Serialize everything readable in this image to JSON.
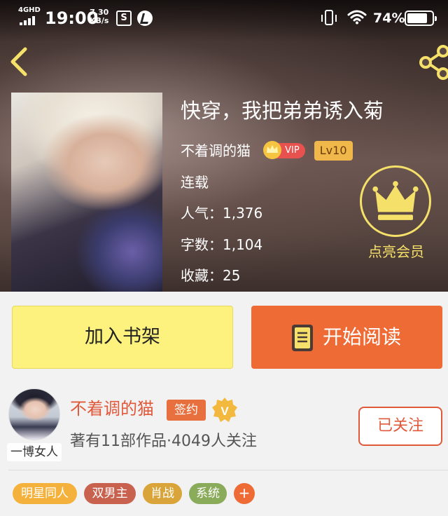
{
  "status_bar": {
    "network": "4GHD",
    "time": "19:00",
    "speed_value": "7.30",
    "speed_unit": "KB/s",
    "battery": "74%",
    "battery_level": 0.74
  },
  "book": {
    "title": "快穿，我把弟弟诱入菊",
    "author": "不着调的猫",
    "vip_label": "VIP",
    "level": "Lv10",
    "status": "连载",
    "popularity": "人气：1,376",
    "word_count": "字数：1,104",
    "favorites": "收藏：25"
  },
  "member": {
    "label": "点亮会员"
  },
  "actions": {
    "add_shelf": "加入书架",
    "start_reading": "开始阅读"
  },
  "author_card": {
    "name": "不着调的猫",
    "sign_badge": "签约",
    "v_badge": "V",
    "summary": "著有11部作品·4049人关注",
    "follow": "已关注",
    "avatar_tag": "一博女人"
  },
  "tags": [
    {
      "label": "明星同人",
      "color": "#f4b23c"
    },
    {
      "label": "双男主",
      "color": "#c8614e"
    },
    {
      "label": "肖战",
      "color": "#d9a53a"
    },
    {
      "label": "系统",
      "color": "#8aab5a"
    },
    {
      "label": "+",
      "color": "#ee6b36"
    }
  ],
  "colors": {
    "accent_orange": "#ee6b36",
    "shelf_yellow": "#fdf27e",
    "author_red": "#e0593b",
    "member_gold": "#f5e06a"
  },
  "icons": {
    "back": "chevron-left-icon",
    "share": "share-icon",
    "member": "crown-icon",
    "read": "book-icon"
  }
}
